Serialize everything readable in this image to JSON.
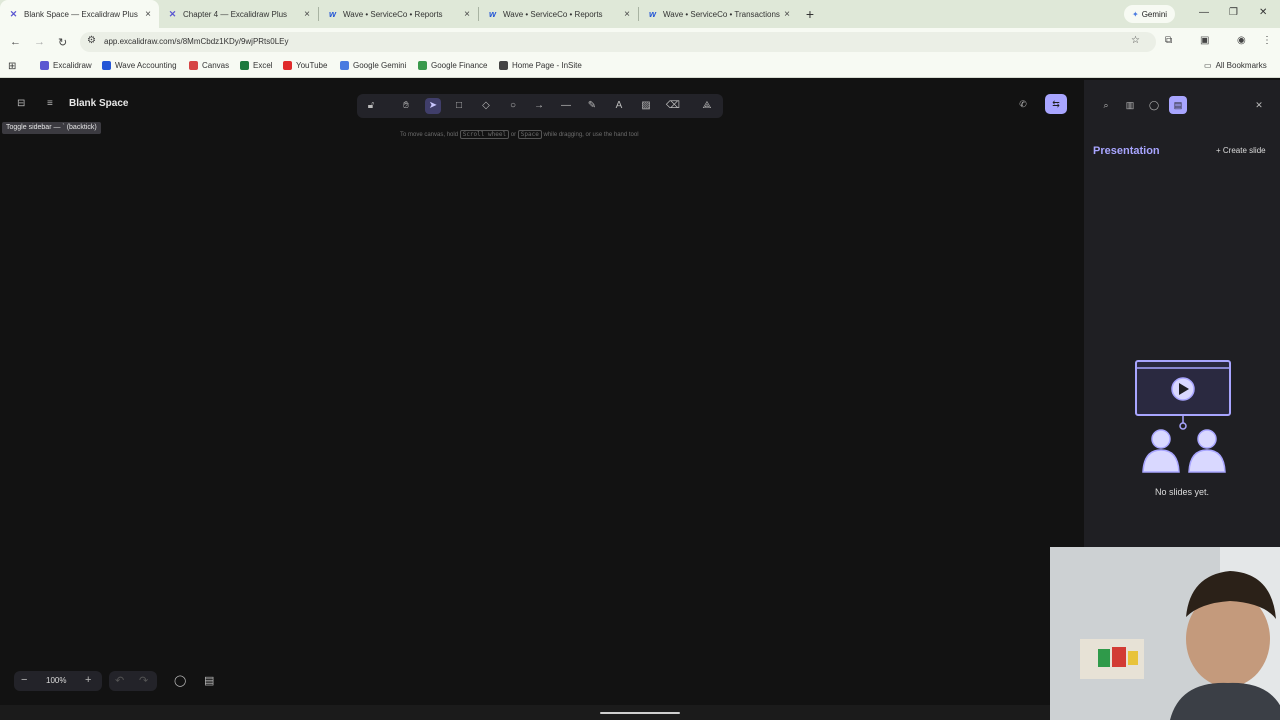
{
  "browser": {
    "tabs": [
      {
        "label": "Blank Space — Excalidraw Plus",
        "icon": "excalidraw-icon",
        "active": true
      },
      {
        "label": "Chapter 4 — Excalidraw Plus",
        "icon": "excalidraw-icon",
        "active": false
      },
      {
        "label": "Wave • ServiceCo • Reports",
        "icon": "wave-icon",
        "active": false
      },
      {
        "label": "Wave • ServiceCo • Reports",
        "icon": "wave-icon",
        "active": false
      },
      {
        "label": "Wave • ServiceCo • Transactions",
        "icon": "wave-icon",
        "active": false
      }
    ],
    "tab_close": "×",
    "new_tab": "+",
    "gemini_label": "Gemini",
    "url": "app.excalidraw.com/s/8MmCbdz1KDy/9wjPRts0LEy",
    "bookmarks": [
      {
        "label": "Excalidraw",
        "color": "#5b57d1"
      },
      {
        "label": "Wave Accounting",
        "color": "#2456d6"
      },
      {
        "label": "Canvas",
        "color": "#d64545"
      },
      {
        "label": "Excel",
        "color": "#1d7a3e"
      },
      {
        "label": "YouTube",
        "color": "#e02b2b"
      },
      {
        "label": "Google Gemini",
        "color": "#4a7be0"
      },
      {
        "label": "Google Finance",
        "color": "#3a9a4c"
      },
      {
        "label": "Home Page - InSite",
        "color": "#444444"
      }
    ],
    "all_bookmarks": "All Bookmarks"
  },
  "app": {
    "doc_title": "Blank Space",
    "sidebar_tooltip": "Toggle sidebar — ` (backtick)",
    "hint": {
      "part1": "To move canvas, hold",
      "key1": "Scroll wheel",
      "part2": "or",
      "key2": "Space",
      "part3": "while dragging, or use the hand tool"
    },
    "zoom_level": "100%",
    "zoom_out": "−",
    "zoom_in": "+"
  },
  "panel": {
    "title": "Presentation",
    "create_slide": "Create slide",
    "empty_message": "No slides yet."
  },
  "colors": {
    "accent": "#a8a5ff",
    "canvas_bg": "#121212",
    "panel_bg": "#1f1f23"
  }
}
